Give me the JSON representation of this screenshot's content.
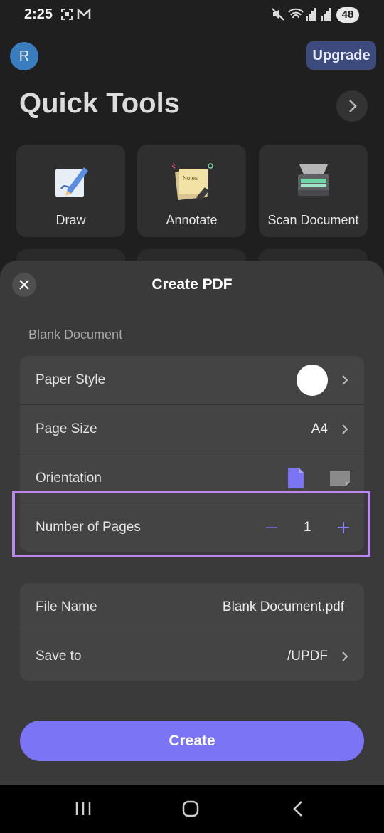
{
  "status_bar": {
    "time": "2:25",
    "battery": "48"
  },
  "header": {
    "avatar_initial": "R",
    "upgrade_label": "Upgrade",
    "title": "Quick Tools"
  },
  "tools": [
    {
      "label": "Draw",
      "icon": "draw-icon"
    },
    {
      "label": "Annotate",
      "icon": "annotate-icon"
    },
    {
      "label": "Scan Document",
      "icon": "scanner-icon"
    }
  ],
  "sheet": {
    "title": "Create PDF",
    "section_label": "Blank Document",
    "paper_style_label": "Paper Style",
    "page_size_label": "Page Size",
    "page_size_value": "A4",
    "orientation_label": "Orientation",
    "orientation_selected": "portrait",
    "number_of_pages_label": "Number of Pages",
    "number_of_pages_value": "1",
    "file_name_label": "File Name",
    "file_name_value": "Blank Document.pdf",
    "save_to_label": "Save to",
    "save_to_value": "/UPDF",
    "create_label": "Create"
  },
  "colors": {
    "accent": "#7b74f5",
    "highlight": "#b88af0",
    "sheet_bg": "#3a3a3a",
    "row_bg": "#444444"
  }
}
